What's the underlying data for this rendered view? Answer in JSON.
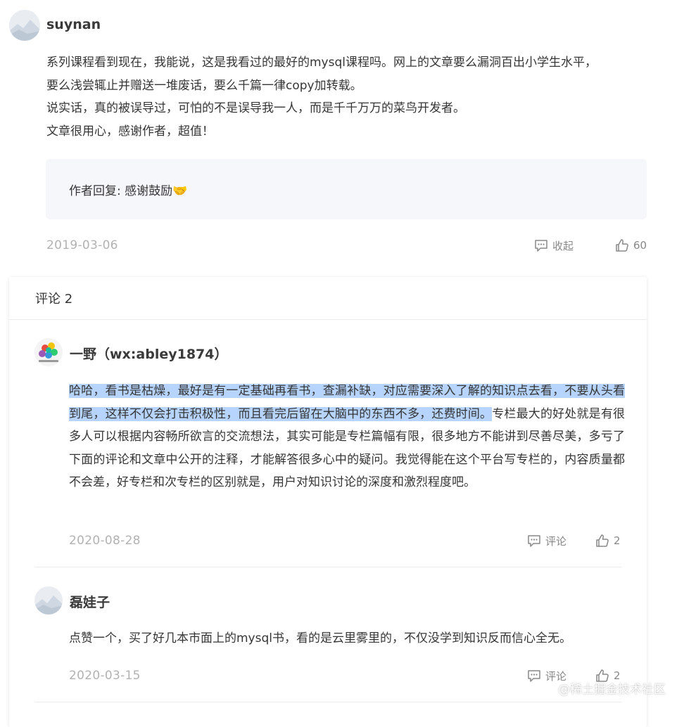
{
  "post": {
    "username": "suynan",
    "content": [
      "系列课程看到现在，我能说，这是我看过的最好的mysql课程吗。网上的文章要么漏洞百出小学生水平，",
      "要么浅尝辄止并赠送一堆废话，要么千篇一律copy加转载。",
      "说实话，真的被误导过，可怕的不是误导我一人，而是千千万万的菜鸟开发者。",
      "文章很用心，感谢作者，超值！"
    ],
    "author_reply": "作者回复: 感谢鼓励🤝",
    "date": "2019-03-06",
    "collapse_label": "收起",
    "likes": "60"
  },
  "comments_section": {
    "header": "评论 2",
    "items": [
      {
        "username": "一野（wx:abley1874）",
        "text_highlighted": "哈哈，看书是枯燥，最好是有一定基础再看书，查漏补缺，对应需要深入了解的知识点去看，不要从头看到尾，这样不仅会打击积极性，而且看完后留在大脑中的东西不多，还费时间。",
        "text_rest": "专栏最大的好处就是有很多人可以根据内容畅所欲言的交流想法，其实可能是专栏篇幅有限，很多地方不能讲到尽善尽美，多亏了下面的评论和文章中公开的注释，才能解答很多心中的疑问。我觉得能在这个平台写专栏的，内容质量都不会差，好专栏和次专栏的区别就是，用户对知识讨论的深度和激烈程度吧。",
        "date": "2020-08-28",
        "comment_label": "评论",
        "likes": "2"
      },
      {
        "username": "磊娃子",
        "text": "点赞一个，买了好几本市面上的mysql书，看的是云里雾里的，不仅没学到知识反而信心全无。",
        "date": "2020-03-15",
        "comment_label": "评论",
        "likes": "2"
      }
    ]
  },
  "watermark": "@稀土掘金技术社区"
}
